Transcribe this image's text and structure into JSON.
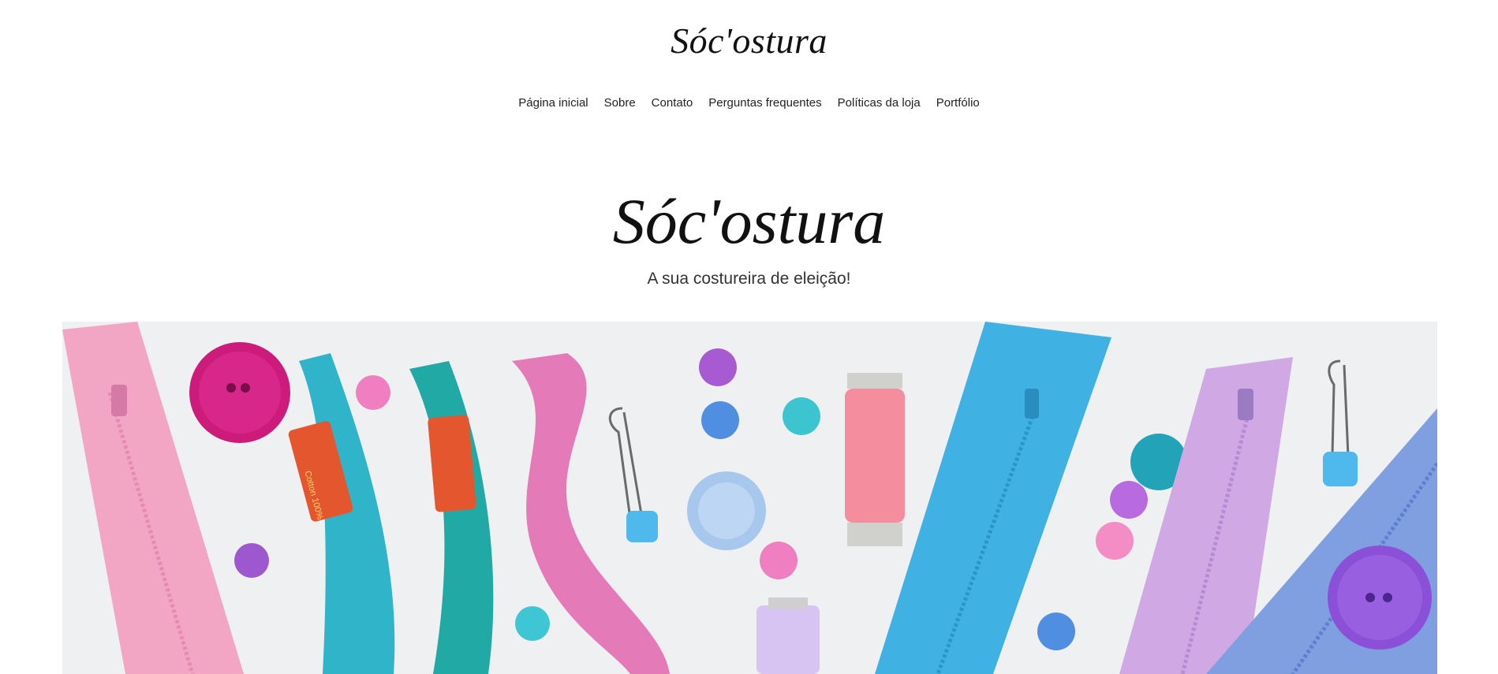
{
  "header": {
    "logo": "Sóc'ostura"
  },
  "nav": {
    "items": [
      {
        "label": "Página inicial"
      },
      {
        "label": "Sobre"
      },
      {
        "label": "Contato"
      },
      {
        "label": "Perguntas frequentes"
      },
      {
        "label": "Políticas da loja"
      },
      {
        "label": "Portfólio"
      }
    ]
  },
  "hero": {
    "title": "Sóc'ostura",
    "subtitle": "A sua costureira de eleição!"
  },
  "banner": {
    "thread_label": "Cotton 100%",
    "colors": {
      "pink": "#f2a6c4",
      "magenta": "#cc1b7a",
      "turquoise": "#2fb4c9",
      "teal": "#21a9a6",
      "blue": "#3fb1e2",
      "lilac": "#cfa8e4",
      "purple": "#8b4fd8",
      "periwinkle": "#7f9fe0"
    }
  }
}
